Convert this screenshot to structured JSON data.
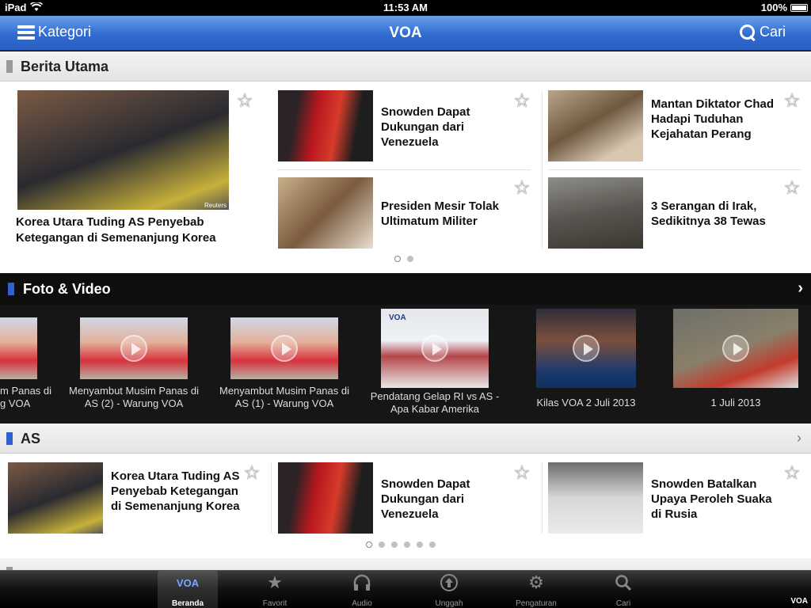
{
  "status_bar": {
    "device": "iPad",
    "time": "11:53 AM",
    "battery": "100%"
  },
  "navbar": {
    "menu_label": "Kategori",
    "title": "VOA",
    "search_label": "Cari"
  },
  "berita_utama": {
    "title": "Berita Utama",
    "featured": {
      "headline": "Korea Utara Tuding AS Penyebab Ketegangan di Semenanjung Korea",
      "credit": "Reuters"
    },
    "items": [
      {
        "headline": "Snowden Dapat Dukungan dari Venezuela"
      },
      {
        "headline": "Mantan Diktator Chad Hadapi Tuduhan Kejahatan Perang"
      },
      {
        "headline": "Presiden Mesir Tolak Ultimatum Militer"
      },
      {
        "headline": "3 Serangan di Irak, Sedikitnya 38 Tewas"
      }
    ]
  },
  "foto_video": {
    "title": "Foto & Video",
    "items": [
      {
        "caption": "m Panas di\ng VOA"
      },
      {
        "caption": "Menyambut Musim Panas di AS (2) - Warung VOA"
      },
      {
        "caption": "Menyambut Musim Panas di AS (1) - Warung VOA"
      },
      {
        "caption": "Pendatang Gelap RI vs AS - Apa Kabar Amerika"
      },
      {
        "caption": "Kilas VOA 2 Juli 2013"
      },
      {
        "caption": "1 Juli 2013"
      }
    ]
  },
  "as": {
    "title": "AS",
    "items": [
      {
        "headline": "Korea Utara Tuding AS Penyebab Ketegangan di Semenanjung Korea"
      },
      {
        "headline": "Snowden Dapat Dukungan dari Venezuela"
      },
      {
        "headline": "Snowden Batalkan Upaya Peroleh Suaka di Rusia"
      }
    ]
  },
  "tabbar": {
    "items": [
      {
        "label": "Beranda",
        "icon": "voa-logo-icon",
        "glyph": "VOA"
      },
      {
        "label": "Favorit",
        "icon": "star-icon"
      },
      {
        "label": "Audio",
        "icon": "headphones-icon"
      },
      {
        "label": "Unggah",
        "icon": "upload-icon"
      },
      {
        "label": "Pengaturan",
        "icon": "gear-icon"
      },
      {
        "label": "Cari",
        "icon": "search-icon"
      }
    ],
    "watermark": "VOA"
  },
  "colors": {
    "nav_blue": "#2f6bd1",
    "section_marker": "#2f5fd0",
    "dark_band": "#161616"
  }
}
